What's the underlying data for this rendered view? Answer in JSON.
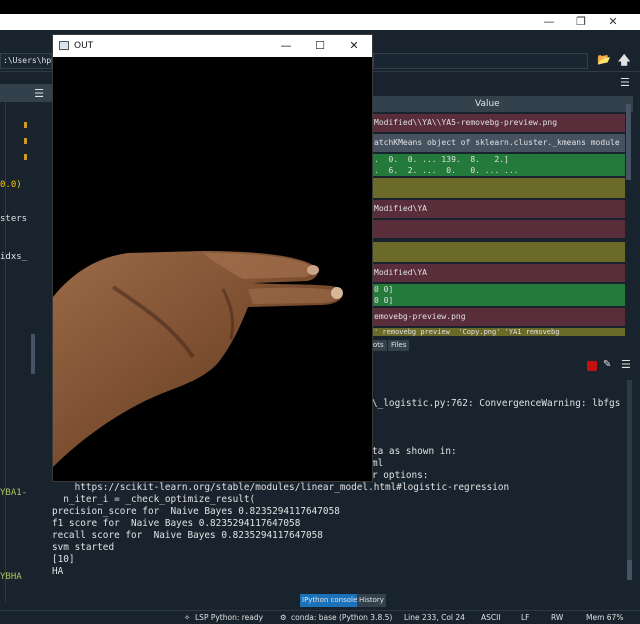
{
  "main_window": {
    "minimize_glyph": "—",
    "maximize_glyph": "❐",
    "close_glyph": "✕"
  },
  "path_bar": {
    "left_fragment": ":\\Users\\hp\\Desl",
    "folder_icon": "folder-icon",
    "up_icon": "arrow-up-icon"
  },
  "editor": {
    "lines": [
      {
        "text": "0.0)",
        "color": "#ffc600"
      },
      {
        "text": "sters",
        "color": "#e0e1e3"
      },
      {
        "text": "idxs_",
        "color": "#e0e1e3"
      },
      {
        "text": "YBA1-",
        "color": "#a7c55b"
      },
      {
        "text": "YBHA",
        "color": "#a7c55b"
      }
    ]
  },
  "variable_explorer": {
    "header_value": "Value",
    "rows": [
      {
        "text": "Modified\\\\YA\\\\YA5-removebg-preview.png",
        "color": "#5a2d3a"
      },
      {
        "text": "atchKMeans object of sklearn.cluster._kmeans module",
        "color": "#46525f"
      },
      {
        "text": ".  0.  0. ... 139.  8.   2.]\n.  6.  2. ...  0.   0. ... ...",
        "color": "#247a3a"
      },
      {
        "text": "",
        "color": "#6b6a29"
      },
      {
        "text": "Modified\\YA",
        "color": "#5a2d3a"
      },
      {
        "text": "",
        "color": "#5a2d3a"
      },
      {
        "text": "",
        "color": "#6b6a29"
      },
      {
        "text": "Modified\\YA",
        "color": "#5a2d3a"
      },
      {
        "text": "0 0]\n0 0]",
        "color": "#247a3a"
      },
      {
        "text": "emovebg-preview.png",
        "color": "#5a2d3a"
      },
      {
        "text": "' removebg preview  'Copy.png' 'YA1 removebg",
        "color": "#6b6a29"
      }
    ],
    "tabs": [
      "ots",
      "Files"
    ]
  },
  "console": {
    "lines": [
      "\\_logistic.py:762: ConvergenceWarning: lbfgs",
      "ta as shown in:",
      "ml",
      "r options:",
      "    https://scikit-learn.org/stable/modules/linear_model.html#logistic-regression",
      "  n_iter_i = _check_optimize_result(",
      "precision_score for  Naive Bayes 0.8235294117647058",
      "f1 score for  Naive Bayes 0.8235294117647058",
      "recall score for  Naive Bayes 0.8235294117647058",
      "svm started",
      "[10]",
      "HA"
    ],
    "tabs": {
      "ipython": "IPython console",
      "history": "History"
    }
  },
  "status_bar": {
    "lsp": "LSP Python: ready",
    "conda": "conda: base (Python 3.8.5)",
    "position": "Line 233, Col 24",
    "encoding": "ASCII",
    "eol": "LF",
    "permissions": "RW",
    "memory": "Mem 67%"
  },
  "out_window": {
    "title": "OUT",
    "minimize_glyph": "—",
    "maximize_glyph": "☐",
    "close_glyph": "✕"
  },
  "colors": {
    "background": "#19232d",
    "panel_header": "#32414b",
    "accent_blue": "#1a72bb",
    "skin": "#8a5a3a"
  }
}
